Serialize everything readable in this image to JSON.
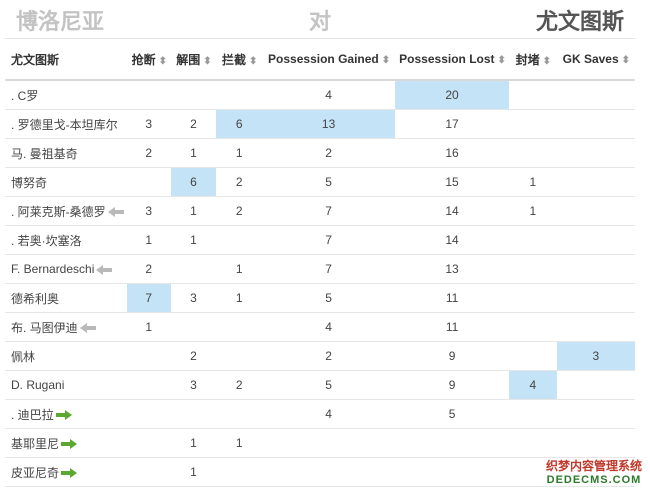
{
  "header": {
    "home_team": "博洛尼亚",
    "vs": "对",
    "away_team": "尤文图斯"
  },
  "table": {
    "columns": [
      "尤文图斯",
      "抢断",
      "解围",
      "拦截",
      "Possession Gained",
      "Possession Lost",
      "封堵",
      "GK Saves"
    ],
    "sort_icon": "⬍",
    "rows": [
      {
        "name": ". C罗",
        "marker": "",
        "cells": [
          "",
          "",
          "",
          "4",
          "20",
          "",
          ""
        ],
        "highlight": [
          4
        ]
      },
      {
        "name": ". 罗德里戈-本坦库尔",
        "marker": "",
        "cells": [
          "3",
          "2",
          "6",
          "13",
          "17",
          "",
          ""
        ],
        "highlight": [
          2,
          3
        ]
      },
      {
        "name": "马. 曼祖基奇",
        "marker": "",
        "cells": [
          "2",
          "1",
          "1",
          "2",
          "16",
          "",
          ""
        ],
        "highlight": []
      },
      {
        "name": "博努奇",
        "marker": "",
        "cells": [
          "",
          "6",
          "2",
          "5",
          "15",
          "1",
          ""
        ],
        "highlight": [
          1
        ]
      },
      {
        "name": ". 阿莱克斯-桑德罗",
        "marker": "sub-out",
        "cells": [
          "3",
          "1",
          "2",
          "7",
          "14",
          "1",
          ""
        ],
        "highlight": []
      },
      {
        "name": ". 若奥·坎塞洛",
        "marker": "",
        "cells": [
          "1",
          "1",
          "",
          "7",
          "14",
          "",
          ""
        ],
        "highlight": []
      },
      {
        "name": "F. Bernardeschi",
        "marker": "sub-out",
        "cells": [
          "2",
          "",
          "1",
          "7",
          "13",
          "",
          ""
        ],
        "highlight": []
      },
      {
        "name": "德希利奥",
        "marker": "",
        "cells": [
          "7",
          "3",
          "1",
          "5",
          "11",
          "",
          ""
        ],
        "highlight": [
          0
        ]
      },
      {
        "name": "布. 马图伊迪",
        "marker": "sub-out",
        "cells": [
          "1",
          "",
          "",
          "4",
          "11",
          "",
          ""
        ],
        "highlight": []
      },
      {
        "name": "佩林",
        "marker": "",
        "cells": [
          "",
          "2",
          "",
          "2",
          "9",
          "",
          "3"
        ],
        "highlight": [
          6
        ]
      },
      {
        "name": "D. Rugani",
        "marker": "",
        "cells": [
          "",
          "3",
          "2",
          "5",
          "9",
          "4",
          ""
        ],
        "highlight": [
          5
        ]
      },
      {
        "name": ". 迪巴拉",
        "marker": "sub-in",
        "cells": [
          "",
          "",
          "",
          "4",
          "5",
          "",
          ""
        ],
        "highlight": []
      },
      {
        "name": "基耶里尼",
        "marker": "sub-in",
        "cells": [
          "",
          "1",
          "1",
          "",
          "",
          "",
          ""
        ],
        "highlight": []
      },
      {
        "name": "皮亚尼奇",
        "marker": "sub-in",
        "cells": [
          "",
          "1",
          "",
          "",
          "",
          "",
          ""
        ],
        "highlight": []
      }
    ]
  },
  "watermark": {
    "line1": "织梦内容管理系统",
    "line2": "DEDECMS.COM"
  },
  "colors": {
    "highlight": "#c4e3f6",
    "sub_in": "#5aa82f",
    "sub_out": "#b9b9b9"
  }
}
